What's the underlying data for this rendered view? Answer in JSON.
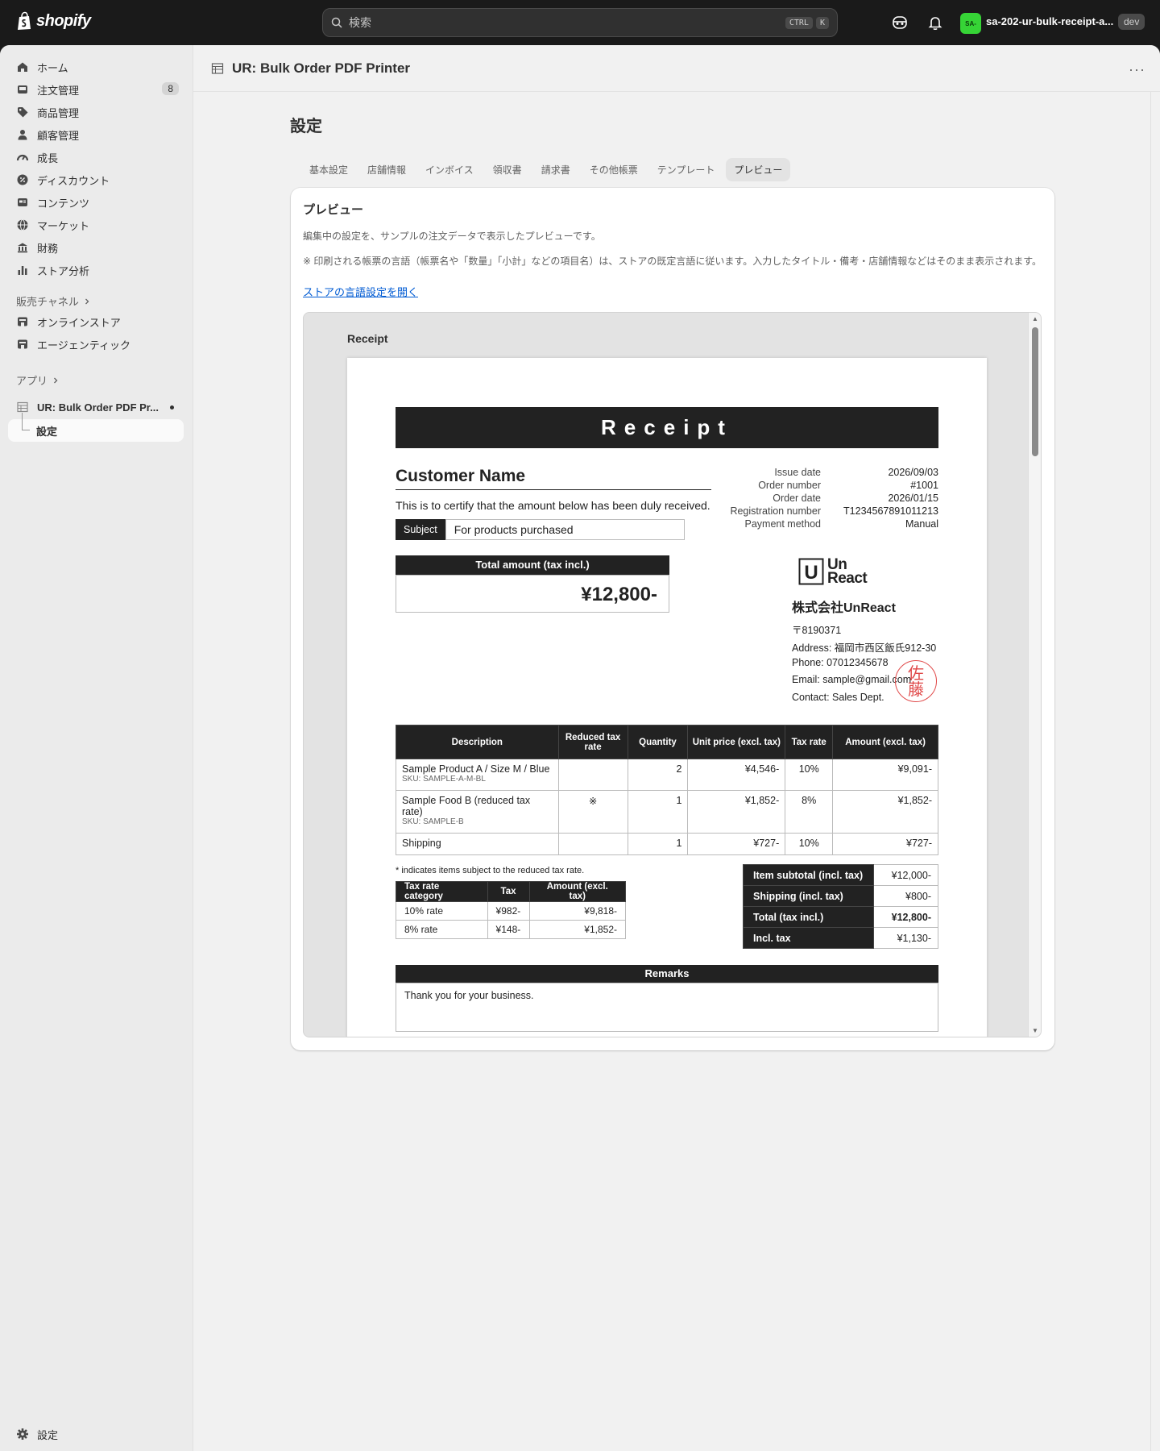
{
  "topbar": {
    "brand": "shopify",
    "search_placeholder": "検索",
    "shortcut_ctrl": "CTRL",
    "shortcut_k": "K",
    "store_initials": "SA-",
    "store_name": "sa-202-ur-bulk-receipt-a...",
    "env_badge": "dev"
  },
  "sidebar": {
    "items": [
      {
        "label": "ホーム",
        "icon": "home-icon"
      },
      {
        "label": "注文管理",
        "icon": "inbox-icon",
        "count": "8"
      },
      {
        "label": "商品管理",
        "icon": "tag-icon"
      },
      {
        "label": "顧客管理",
        "icon": "person-icon"
      },
      {
        "label": "成長",
        "icon": "gauge-icon"
      },
      {
        "label": "ディスカウント",
        "icon": "discount-icon"
      },
      {
        "label": "コンテンツ",
        "icon": "content-icon"
      },
      {
        "label": "マーケット",
        "icon": "globe-icon"
      },
      {
        "label": "財務",
        "icon": "bank-icon"
      },
      {
        "label": "ストア分析",
        "icon": "analytics-icon"
      }
    ],
    "sales_channels_label": "販売チャネル",
    "channels": [
      {
        "label": "オンラインストア",
        "icon": "store-icon"
      },
      {
        "label": "エージェンティック",
        "icon": "store-icon"
      }
    ],
    "apps_label": "アプリ",
    "app_name": "UR: Bulk Order PDF Pr...",
    "app_sub": "設定",
    "settings_label": "設定"
  },
  "header": {
    "app_title": "UR: Bulk Order PDF Printer",
    "more": "···"
  },
  "page": {
    "title": "設定",
    "tabs": [
      "基本設定",
      "店舗情報",
      "インボイス",
      "領収書",
      "請求書",
      "その他帳票",
      "テンプレート",
      "プレビュー"
    ],
    "active_tab": "プレビュー"
  },
  "card": {
    "title": "プレビュー",
    "desc": "編集中の設定を、サンプルの注文データで表示したプレビューです。",
    "note": "※ 印刷される帳票の言語（帳票名や「数量」「小計」などの項目名）は、ストアの既定言語に従います。入力したタイトル・備考・店舗情報などはそのまま表示されます。",
    "link": "ストアの言語設定を開く",
    "preview_label": "Receipt"
  },
  "receipt": {
    "title": "Receipt",
    "customer": "Customer Name",
    "certify": "This is to certify that the amount below has been duly received.",
    "subject_label": "Subject",
    "subject_value": "For products purchased",
    "meta": [
      {
        "k": "Issue date",
        "v": "2026/09/03"
      },
      {
        "k": "Order number",
        "v": "#1001"
      },
      {
        "k": "Order date",
        "v": "2026/01/15"
      },
      {
        "k": "Registration number",
        "v": "T1234567891011213"
      },
      {
        "k": "Payment method",
        "v": "Manual"
      }
    ],
    "total_label": "Total amount (tax incl.)",
    "total_value": "¥12,800-",
    "logo_line1": "Un",
    "logo_line2": "React",
    "logo_mark": "U",
    "company": "株式会社UnReact",
    "postal": "〒8190371",
    "address": "Address: 福岡市西区飯氏912-30",
    "phone": "Phone: 07012345678",
    "email": "Email: sample@gmail.com",
    "contact": "Contact: Sales Dept.",
    "seal_top": "佐",
    "seal_bottom": "藤",
    "columns": [
      "Description",
      "Reduced tax rate",
      "Quantity",
      "Unit price (excl. tax)",
      "Tax rate",
      "Amount (excl. tax)"
    ],
    "rows": [
      {
        "desc": "Sample Product A / Size M / Blue",
        "sku": "SKU: SAMPLE-A-M-BL",
        "reduced": "",
        "qty": "2",
        "unit": "¥4,546-",
        "rate": "10%",
        "amount": "¥9,091-"
      },
      {
        "desc": "Sample Food B (reduced tax rate)",
        "sku": "SKU: SAMPLE-B",
        "reduced": "※",
        "qty": "1",
        "unit": "¥1,852-",
        "rate": "8%",
        "amount": "¥1,852-"
      },
      {
        "desc": "Shipping",
        "sku": "",
        "reduced": "",
        "qty": "1",
        "unit": "¥727-",
        "rate": "10%",
        "amount": "¥727-"
      }
    ],
    "footnote": "* indicates items subject to the reduced tax rate.",
    "tax_columns": [
      "Tax rate category",
      "Tax",
      "Amount (excl. tax)"
    ],
    "tax_rows": [
      {
        "cat": "10% rate",
        "tax": "¥982-",
        "amt": "¥9,818-"
      },
      {
        "cat": "8% rate",
        "tax": "¥148-",
        "amt": "¥1,852-"
      }
    ],
    "summary": [
      {
        "k": "Item subtotal (incl. tax)",
        "v": "¥12,000-"
      },
      {
        "k": "Shipping (incl. tax)",
        "v": "¥800-"
      },
      {
        "k": "Total (tax incl.)",
        "v": "¥12,800-"
      },
      {
        "k": "Incl. tax",
        "v": "¥1,130-"
      }
    ],
    "remarks_label": "Remarks",
    "remarks_text": "Thank you for your business."
  }
}
